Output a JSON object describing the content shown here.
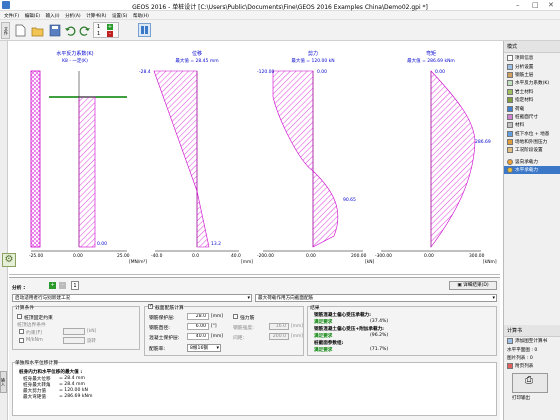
{
  "app_title": "GEOS 2016 - 单桩设计 [C:\\Users\\Public\\Documents\\Fine\\GEOS 2016 Examples China\\Demo02.gpi *]",
  "window_controls": {
    "minimize": "–",
    "maximize": "□",
    "close": "✕"
  },
  "menu": [
    "文件(F)",
    "编辑(E)",
    "输入(I)",
    "分析(A)",
    "计算书(R)",
    "设置(S)",
    "帮助(H)"
  ],
  "toolbar": {
    "side_tab": "文件",
    "layer_items": [
      "1",
      "1"
    ]
  },
  "left_tab": "输入",
  "diagrams": {
    "x_axis_labels": [
      "-25.00",
      "0.00",
      "25.00",
      "-40.0",
      "0.0",
      "40.0",
      "-200.00",
      "0.00",
      "200.00",
      "-300.00",
      "0.00",
      "300.00"
    ],
    "units": [
      "[MN/m³]",
      "[mm]",
      "[kN]",
      "[kNm]"
    ],
    "panel1": {
      "title": "水平反力系数(K)",
      "subtitle": "K8 - 一定(K)",
      "value_bottom": "0.00"
    },
    "panel2": {
      "title": "位移",
      "subtitle": "最大值 = 28.45 mm",
      "value_top": "-28.4",
      "value_bottom": "13.2"
    },
    "panel3": {
      "title": "剪力",
      "subtitle": "最大值 = 120.00 kN",
      "value_top": "-120.00",
      "value_top_right": "0.00",
      "value_mid": "90.65"
    },
    "panel4": {
      "title": "弯矩",
      "subtitle": "最大值 = 286.69 kNm",
      "value_top": "0.00",
      "value_mid": "286.69"
    }
  },
  "right_panel": {
    "mode_title": "模式",
    "items": [
      "项目信息",
      "分析设置",
      "钢筋土层",
      "水平反力系数(K)",
      "岩土材料",
      "指定材料",
      "荷载",
      "桩截面尺寸",
      "材料",
      "桩下水位 + 地基",
      "场地和外围压力",
      "工况阶段设置",
      "竖向承载力",
      "水平承载力"
    ],
    "active_index": 13,
    "calc_title": "计算书",
    "calc_items": [
      "添加图至计算书",
      "水平平面图 : 0",
      "图片列表 : 0",
      "附页列表"
    ],
    "print_label": "打印输出"
  },
  "bottom": {
    "analysis_label": "分析 :",
    "tab_number": "1",
    "detail_button": "详细结果(D)",
    "method_value": "启动适用者行与别新建工况",
    "result_mode_value": "最大荷载作用方向截面配筋",
    "calc_group": "计算条件",
    "chk_group": "截面配筋计算",
    "chk_cond1": "桩顶固定约束",
    "cond_label": "桩顶边界条件",
    "cond_fixed": "约束(F)",
    "cond_moment": "M/kNm",
    "cond_rotation": "旋转",
    "fixed_unit": "[kN]",
    "cover_label": "钢筋保护层:",
    "cover_value": "28.0",
    "cover_unit": "[mm]",
    "bar_dia_label": "钢筋直径:",
    "bar_dia_value": "6.00",
    "bar_dia_unit": "[°]",
    "conc_label": "混凝土保护层:",
    "conc_value": "40.0",
    "conc_unit": "[mm]",
    "bar_count_label": "配筋率:",
    "bar_count_value": "8根16钢",
    "chk_strong": "强力筋",
    "strong_label1": "钢筋强度:",
    "strong_value1": "16.0",
    "strong_unit1": "[mm]",
    "strong_label2": "间距:",
    "strong_value2": "200.0",
    "strong_unit2": "[mm]",
    "results_title": "结果",
    "results": [
      {
        "label": "钢筋混凝土偏心受压承载力:",
        "status": "",
        "pct": ""
      },
      {
        "label": "满足要求",
        "status": "ok",
        "pct": "(37.4%)"
      },
      {
        "label": "钢筋混凝土偏心受压+附加承载力:",
        "status": "",
        "pct": ""
      },
      {
        "label": "满足要求",
        "status": "ok",
        "pct": "(96.2%)"
      },
      {
        "label": "桩截面参数组:",
        "status": "",
        "pct": ""
      },
      {
        "label": "满足要求",
        "status": "ok",
        "pct": "(71.7%)"
      }
    ],
    "summary_group": "单独和水平位移计算",
    "summary_header": "桩身内力和水平位移的最大值 :",
    "summary_rows": [
      {
        "label": "桩身最大位移",
        "value": "= 28.4 mm"
      },
      {
        "label": "桩身最大转角",
        "value": "= 28.4 mm"
      },
      {
        "label": "最大剪力值",
        "value": "= 120.00 kN"
      },
      {
        "label": "最大弯矩值",
        "value": "= 286.69 kNm"
      }
    ]
  },
  "colors": {
    "accent": "#3b78c8",
    "pile": "#cc00cc",
    "hatch": "#e040e0",
    "ground": "#008000",
    "ok": "#008000"
  }
}
